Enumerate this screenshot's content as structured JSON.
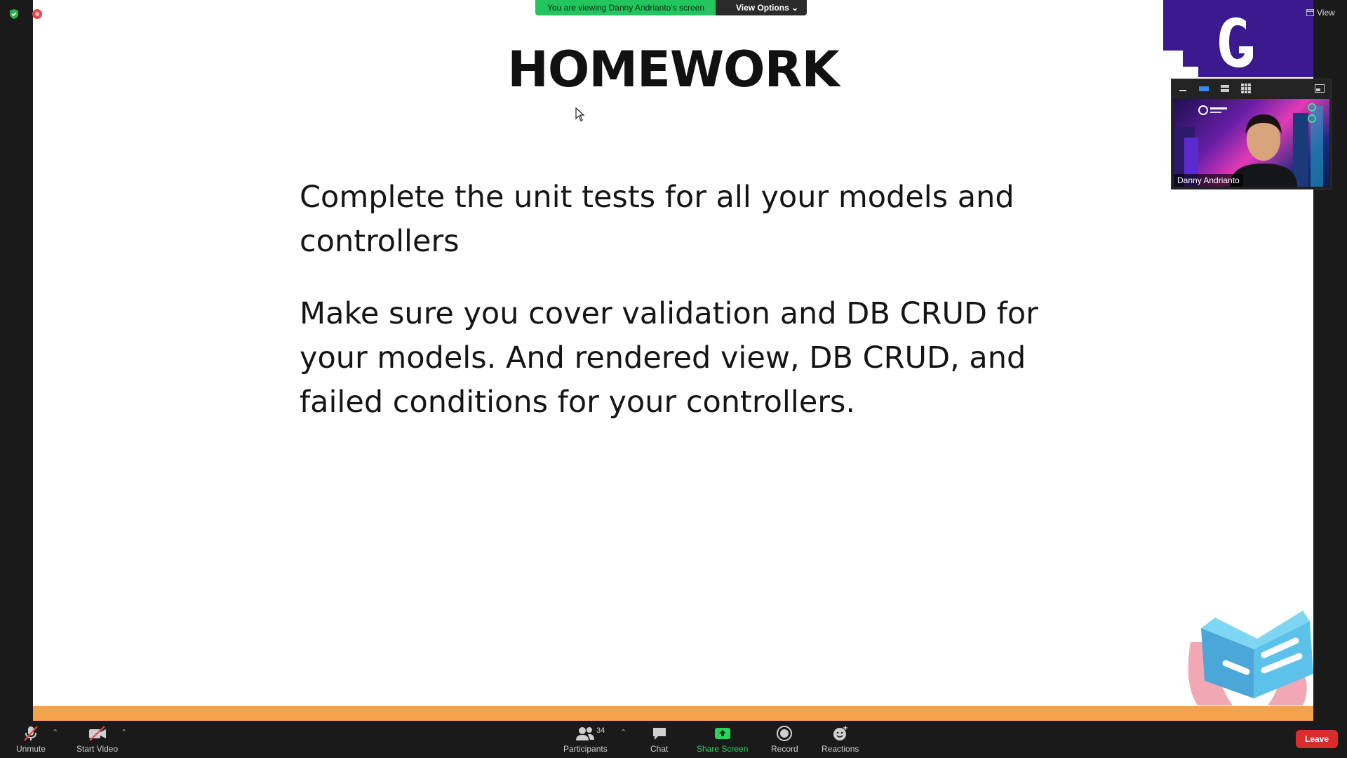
{
  "share_banner": {
    "message": "You are viewing Danny Andrianto's screen",
    "options_label": "View Options"
  },
  "view_button": {
    "label": "View"
  },
  "slide": {
    "title": "HOMEWORK",
    "paragraphs": [
      "Complete the unit tests for all your models and controllers",
      "Make sure you cover validation and DB CRUD for your models. And rendered view, DB CRUD, and failed conditions for your controllers."
    ],
    "accent_color": "#f5a24a"
  },
  "brand": {
    "logo_letter": "G",
    "color": "#3a1a8c"
  },
  "video": {
    "participant_name": "Danny Andrianto"
  },
  "toolbar": {
    "unmute_label": "Unmute",
    "start_video_label": "Start Video",
    "participants_label": "Participants",
    "participants_count": "34",
    "chat_label": "Chat",
    "share_screen_label": "Share Screen",
    "record_label": "Record",
    "reactions_label": "Reactions",
    "leave_label": "Leave"
  },
  "colors": {
    "share_green": "#23c55e",
    "leave_red": "#d92d2d"
  }
}
